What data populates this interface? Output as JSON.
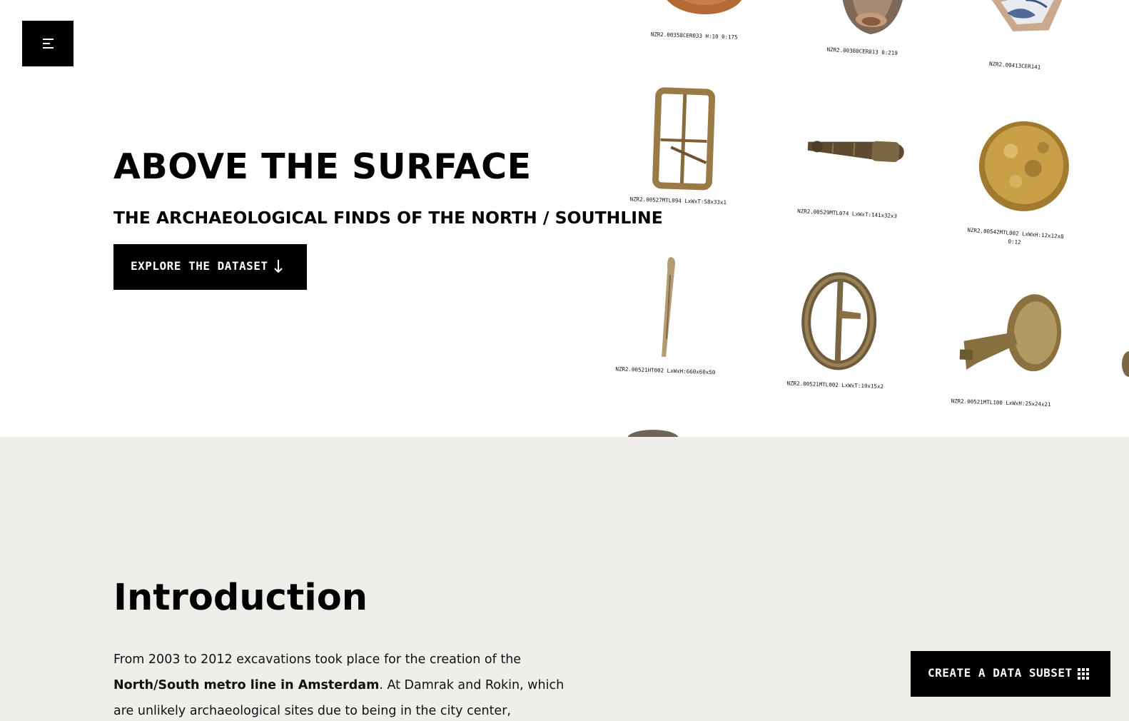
{
  "header": {
    "menu_icon": "menu-icon"
  },
  "hero": {
    "title": "ABOVE THE SURFACE",
    "subtitle": "THE ARCHAEOLOGICAL FINDS OF THE NORTH / SOUTHLINE",
    "explore_button": {
      "label": "EXPLORE THE DATASET",
      "icon": "arrow-down-icon"
    }
  },
  "finds": [
    {
      "caption": "NZR2.00358CER033 H:10 0:175",
      "object": "ceramic-bowl"
    },
    {
      "caption": "NZR2.00380CER013 0:219",
      "object": "stoneware-jug"
    },
    {
      "caption": "NZR2.00413CER141",
      "object": "blue-white-sherd"
    },
    {
      "caption": "NZR2.00527MTL094 LxWxT:58x33x1",
      "object": "rectangular-buckle"
    },
    {
      "caption": "NZR2.00529MTL074 LxWxT:141x32x3",
      "object": "metal-pin"
    },
    {
      "caption": "NZR2.00542MTL002 LxWxH:12x12x8",
      "caption_2": "0:12",
      "object": "button"
    },
    {
      "caption": "NZR2.00521HT002 LxWxH:660x60x50",
      "object": "bone-stick"
    },
    {
      "caption": "NZR2.00521MTL002 LxWxT:19x15x2",
      "object": "oval-buckle"
    },
    {
      "caption": "NZR2.00521MTL100 LxWxH:25x24x21",
      "object": "thimble-fitting"
    }
  ],
  "intro": {
    "title": "Introduction",
    "text_1": "From 2003 to 2012 excavations took place for the creation of the ",
    "text_bold": "North/South metro line in Amsterdam",
    "text_2": ". At Damrak and Rokin, which are unlikely archaeological sites due to being in the city center, archaeologists had a chance"
  },
  "subset_button": {
    "label": "CREATE A DATA SUBSET",
    "icon": "grid-icon"
  }
}
